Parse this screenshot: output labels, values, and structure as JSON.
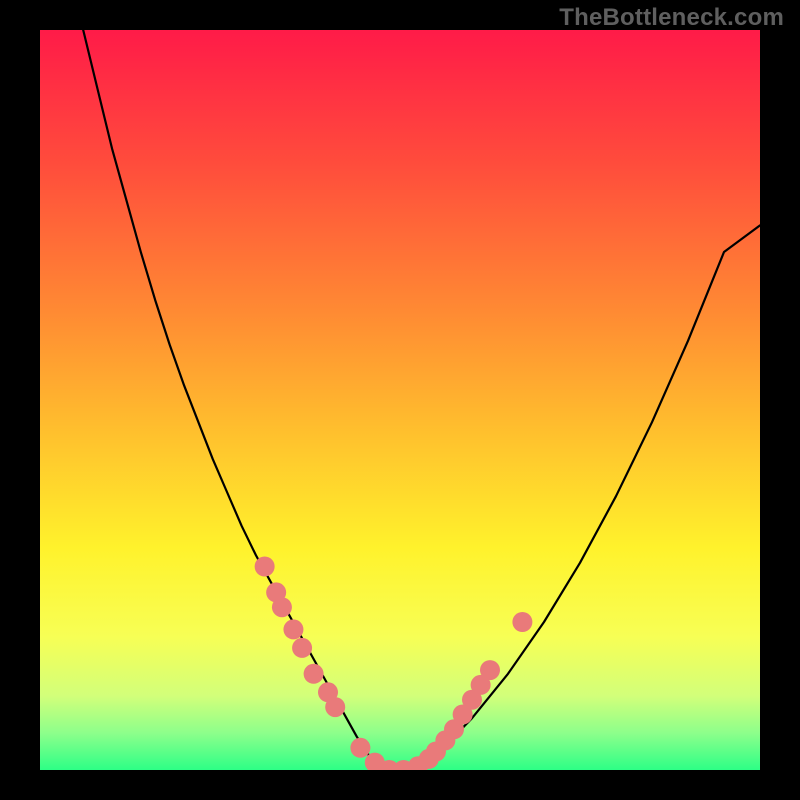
{
  "watermark": "TheBottleneck.com",
  "chart_data": {
    "type": "line",
    "title": "",
    "xlabel": "",
    "ylabel": "",
    "xlim": [
      0,
      100
    ],
    "ylim": [
      0,
      100
    ],
    "grid": false,
    "legend": false,
    "background_gradient": {
      "stops": [
        {
          "offset": 0.0,
          "color": "#ff1b48"
        },
        {
          "offset": 0.18,
          "color": "#ff4c3c"
        },
        {
          "offset": 0.38,
          "color": "#ff8a33"
        },
        {
          "offset": 0.55,
          "color": "#ffc22d"
        },
        {
          "offset": 0.7,
          "color": "#fff22c"
        },
        {
          "offset": 0.82,
          "color": "#f7ff55"
        },
        {
          "offset": 0.9,
          "color": "#d2ff7a"
        },
        {
          "offset": 0.95,
          "color": "#8dff8b"
        },
        {
          "offset": 1.0,
          "color": "#2dff86"
        }
      ]
    },
    "series": [
      {
        "name": "bottleneck-curve",
        "color": "#000000",
        "x": [
          6,
          8,
          10,
          12,
          14,
          16,
          18,
          20,
          22,
          24,
          26,
          28,
          30,
          32,
          34,
          36,
          38,
          40,
          42,
          44,
          46,
          48,
          50,
          55,
          60,
          65,
          70,
          75,
          80,
          85,
          90,
          95,
          100
        ],
        "y": [
          100,
          92,
          84,
          77,
          70,
          63.5,
          57.5,
          52,
          47,
          42,
          37.5,
          33,
          29,
          25.5,
          22,
          18.5,
          15,
          11.5,
          8,
          4.5,
          1.5,
          0,
          0,
          2,
          7,
          13,
          20,
          28,
          37,
          47,
          58,
          70,
          73.6
        ]
      }
    ],
    "markers": {
      "name": "highlight-dots",
      "color": "#e97a7a",
      "radius": 10,
      "points": [
        {
          "x": 31.2,
          "y": 27.5
        },
        {
          "x": 32.8,
          "y": 24.0
        },
        {
          "x": 33.6,
          "y": 22.0
        },
        {
          "x": 35.2,
          "y": 19.0
        },
        {
          "x": 36.4,
          "y": 16.5
        },
        {
          "x": 38.0,
          "y": 13.0
        },
        {
          "x": 40.0,
          "y": 10.5
        },
        {
          "x": 41.0,
          "y": 8.5
        },
        {
          "x": 44.5,
          "y": 3.0
        },
        {
          "x": 46.5,
          "y": 1.0
        },
        {
          "x": 48.5,
          "y": 0.0
        },
        {
          "x": 50.5,
          "y": 0.0
        },
        {
          "x": 52.5,
          "y": 0.5
        },
        {
          "x": 54.0,
          "y": 1.5
        },
        {
          "x": 55.0,
          "y": 2.5
        },
        {
          "x": 56.3,
          "y": 4.0
        },
        {
          "x": 57.5,
          "y": 5.5
        },
        {
          "x": 58.7,
          "y": 7.5
        },
        {
          "x": 60.0,
          "y": 9.5
        },
        {
          "x": 61.2,
          "y": 11.5
        },
        {
          "x": 62.5,
          "y": 13.5
        },
        {
          "x": 67.0,
          "y": 20.0
        }
      ]
    }
  }
}
